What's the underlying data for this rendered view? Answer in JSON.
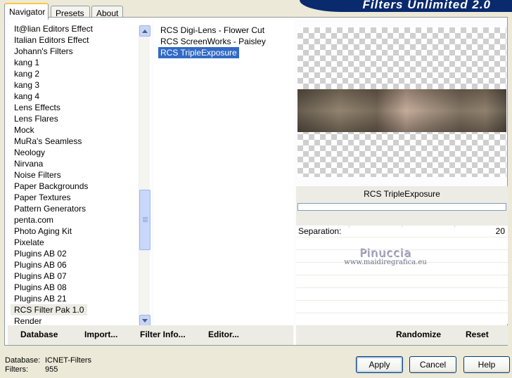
{
  "tabs": {
    "navigator": "Navigator",
    "presets": "Presets",
    "about": "About"
  },
  "banner": {
    "title": "Filters Unlimited 2.0"
  },
  "categories": {
    "items": [
      "It@lian Editors Effect",
      "Italian Editors Effect",
      "Johann's Filters",
      "kang 1",
      "kang 2",
      "kang 3",
      "kang 4",
      "Lens Effects",
      "Lens Flares",
      "Mock",
      "MuRa's Seamless",
      "Neology",
      "Nirvana",
      "Noise Filters",
      "Paper Backgrounds",
      "Paper Textures",
      "Pattern Generators",
      "penta.com",
      "Photo Aging Kit",
      "Pixelate",
      "Plugins AB 02",
      "Plugins AB 06",
      "Plugins AB 07",
      "Plugins AB 08",
      "Plugins AB 21",
      "RCS Filter Pak 1.0",
      "Render"
    ],
    "selected": "RCS Filter Pak 1.0"
  },
  "filters": {
    "items": [
      "RCS Digi-Lens - Flower Cut",
      "RCS ScreenWorks - Paisley",
      "RCS TripleExposure"
    ],
    "selected": "RCS TripleExposure"
  },
  "current_filter": "RCS TripleExposure",
  "params": {
    "separation_label": "Separation:",
    "separation_value": "20"
  },
  "watermark": {
    "title": "Pinuccia",
    "url": "www.maidiregrafica.eu"
  },
  "toolbar": {
    "database": "Database",
    "import": "Import...",
    "filter_info": "Filter Info...",
    "editor": "Editor...",
    "randomize": "Randomize",
    "reset": "Reset"
  },
  "footer": {
    "database_label": "Database:",
    "database_value": "ICNET-Filters",
    "filters_label": "Filters:",
    "filters_value": "955"
  },
  "buttons": {
    "apply": "Apply",
    "cancel": "Cancel",
    "help": "Help"
  }
}
